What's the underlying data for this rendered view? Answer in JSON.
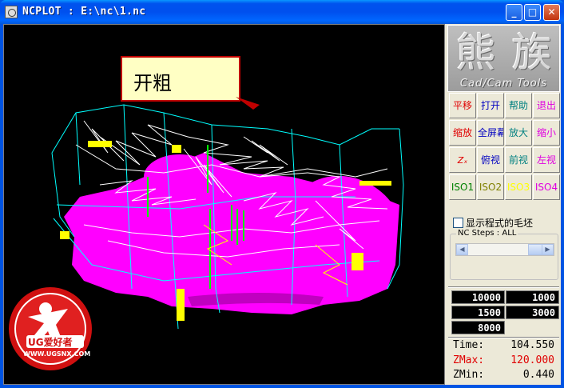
{
  "window": {
    "title": "NCPLOT : E:\\nc\\1.nc",
    "min": "0",
    "max": "1",
    "close": "r"
  },
  "logo": {
    "chars": "熊 族",
    "subtitle": "Cad/Cam Tools"
  },
  "callout": {
    "text": "开粗"
  },
  "watermark": {
    "brand": "UG爱好者",
    "url": "WWW.UGSNX.COM"
  },
  "buttons": [
    {
      "label": "平移",
      "color": "#e00000"
    },
    {
      "label": "打开",
      "color": "#0000c0"
    },
    {
      "label": "帮助",
      "color": "#008080"
    },
    {
      "label": "退出",
      "color": "#e000e0"
    },
    {
      "label": "缩放",
      "color": "#e00000"
    },
    {
      "label": "全屏幕",
      "color": "#0000c0"
    },
    {
      "label": "放大",
      "color": "#008080"
    },
    {
      "label": "缩小",
      "color": "#e000e0"
    },
    {
      "label": "",
      "color": "#e00000",
      "icon": "axis-icon"
    },
    {
      "label": "俯视",
      "color": "#0000c0"
    },
    {
      "label": "前视",
      "color": "#008080"
    },
    {
      "label": "左视",
      "color": "#e000e0"
    },
    {
      "label": "ISO1",
      "color": "#008000"
    },
    {
      "label": "ISO2",
      "color": "#808000"
    },
    {
      "label": "ISO3",
      "color": "#ffff00"
    },
    {
      "label": "ISO4",
      "color": "#e000e0"
    }
  ],
  "checkbox": {
    "label": "显示程式的毛坯",
    "checked": false
  },
  "ncsteps": {
    "label": "NC Steps : ALL",
    "left": "<",
    "right": ">"
  },
  "numbers": [
    "10000",
    "1000",
    "1500",
    "3000",
    "8000"
  ],
  "stats": {
    "time_label": "Time:",
    "time": "104.550",
    "zmax_label": "ZMax:",
    "zmax": "120.000",
    "zmin_label": "ZMin:",
    "zmin": "0.440"
  },
  "colors": {
    "part": "#ff00ff",
    "rapid": "#00ffff",
    "cut": "#ffffff",
    "accent": "#ffff00",
    "green": "#00ff00"
  }
}
